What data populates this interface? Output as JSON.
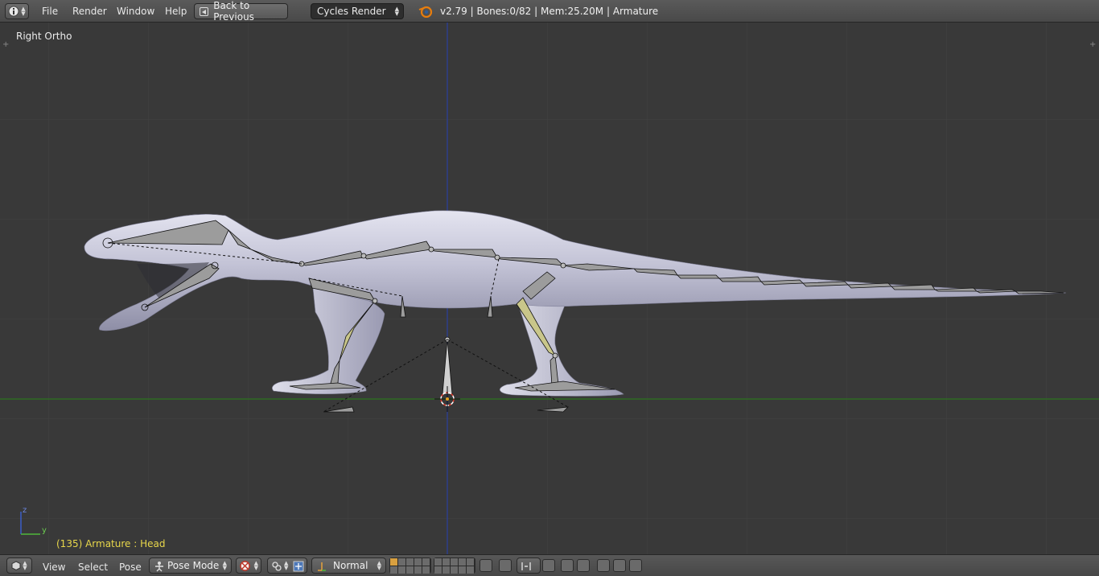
{
  "top_header": {
    "menus": [
      "File",
      "Render",
      "Window",
      "Help"
    ],
    "back_button": "Back to Previous",
    "render_engine": "Cycles Render",
    "stats": "v2.79 | Bones:0/82  | Mem:25.20M | Armature"
  },
  "viewport": {
    "view_name": "Right Ortho",
    "frame_info": "(135) Armature : Head",
    "axis_z": "z",
    "axis_y": "y"
  },
  "bottom_header": {
    "menus": [
      "View",
      "Select",
      "Pose"
    ],
    "mode": "Pose Mode",
    "transform_orientation": "Normal"
  },
  "colors": {
    "viewport_bg": "#393939",
    "header_bg": "#4f4f4f",
    "y_axis_line": "#2f6a22",
    "z_axis_line": "#2d3f8a",
    "frame_info_text": "#e8d74b",
    "selected_bone": "#c9c68a"
  },
  "icons": [
    "info-icon",
    "blender-logo-icon",
    "3d-view-icon",
    "pose-mode-icon",
    "pivot-icon",
    "snap-icon",
    "manipulator-icon",
    "render-icon"
  ]
}
